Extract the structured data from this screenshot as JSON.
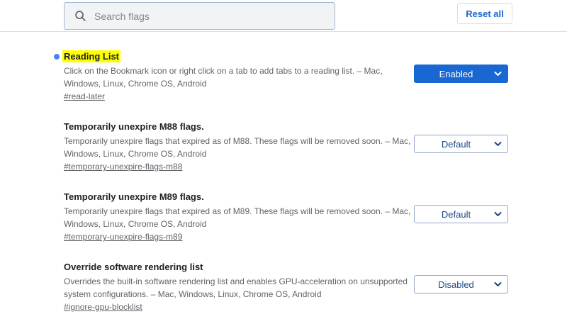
{
  "header": {
    "search_placeholder": "Search flags",
    "reset_all_label": "Reset all"
  },
  "colors": {
    "accent_blue": "#1967d2",
    "enabled_select_bg": "#1967d2",
    "select_text_navy": "#1d4886",
    "match_dot_blue": "#4285f4",
    "search_highlight_yellow": "#ffff00",
    "title_text": "#202124",
    "secondary_text": "#5f6368"
  },
  "flags": [
    {
      "title": "Reading List",
      "highlighted": true,
      "description": "Click on the Bookmark icon or right click on a tab to add tabs to a reading list. – Mac,\nWindows, Linux, Chrome OS, Android",
      "link": "#read-later",
      "selected": "Enabled"
    },
    {
      "title": "Temporarily unexpire M88 flags.",
      "highlighted": false,
      "description": "Temporarily unexpire flags that expired as of M88. These flags will be removed soon. – Mac,\nWindows, Linux, Chrome OS, Android",
      "link": "#temporary-unexpire-flags-m88",
      "selected": "Default"
    },
    {
      "title": "Temporarily unexpire M89 flags.",
      "highlighted": false,
      "description": "Temporarily unexpire flags that expired as of M89. These flags will be removed soon. – Mac,\nWindows, Linux, Chrome OS, Android",
      "link": "#temporary-unexpire-flags-m89",
      "selected": "Default"
    },
    {
      "title": "Override software rendering list",
      "highlighted": false,
      "description": "Overrides the built-in software rendering list and enables GPU-acceleration on unsupported\nsystem configurations. – Mac, Windows, Linux, Chrome OS, Android",
      "link": "#ignore-gpu-blocklist",
      "selected": "Disabled"
    }
  ]
}
